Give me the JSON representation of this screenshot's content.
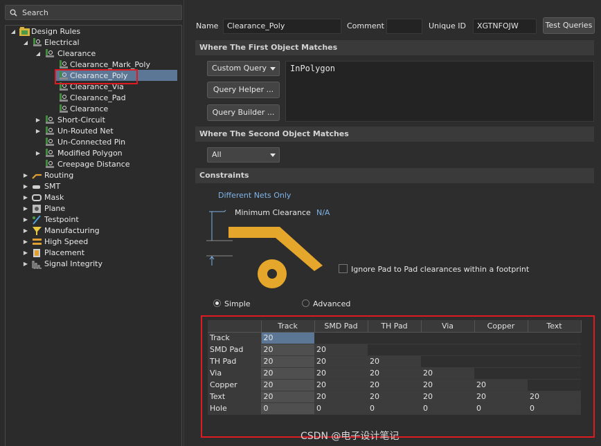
{
  "search": {
    "placeholder": "Search",
    "icon": "search-icon"
  },
  "tree": {
    "root": "Design Rules",
    "electrical": "Electrical",
    "clearance": "Clearance",
    "clearance_children": [
      "Clearance_Mark_Poly",
      "Clearance_Poly",
      "Clearance_Via",
      "Clearance_Pad",
      "Clearance"
    ],
    "electrical_children": [
      "Short-Circuit",
      "Un-Routed Net",
      "Un-Connected Pin",
      "Modified Polygon",
      "Creepage Distance"
    ],
    "categories": [
      "Routing",
      "SMT",
      "Mask",
      "Plane",
      "Testpoint",
      "Manufacturing",
      "High Speed",
      "Placement",
      "Signal Integrity"
    ]
  },
  "rule": {
    "name_label": "Name",
    "name_value": "Clearance_Poly",
    "comment_label": "Comment",
    "comment_value": "",
    "uid_label": "Unique ID",
    "uid_value": "XGTNFOJW",
    "test_button": "Test Queries"
  },
  "first_object": {
    "header": "Where The First Object Matches",
    "combo": "Custom Query",
    "query_helper": "Query Helper ...",
    "query_builder": "Query Builder ...",
    "query_text": "InPolygon"
  },
  "second_object": {
    "header": "Where The Second Object Matches",
    "combo": "All"
  },
  "constraints": {
    "header": "Constraints",
    "net_scope": "Different Nets Only",
    "min_clearance_label": "Minimum Clearance",
    "min_clearance_value": "N/A",
    "ignore_pad_label": "Ignore Pad to Pad clearances within a footprint",
    "mode_simple": "Simple",
    "mode_advanced": "Advanced",
    "selected_mode": "Simple"
  },
  "grid": {
    "columns": [
      "Track",
      "SMD Pad",
      "TH Pad",
      "Via",
      "Copper",
      "Text"
    ],
    "rows": [
      {
        "name": "Track",
        "values": [
          "20"
        ]
      },
      {
        "name": "SMD Pad",
        "values": [
          "20",
          "20"
        ]
      },
      {
        "name": "TH Pad",
        "values": [
          "20",
          "20",
          "20"
        ]
      },
      {
        "name": "Via",
        "values": [
          "20",
          "20",
          "20",
          "20"
        ]
      },
      {
        "name": "Copper",
        "values": [
          "20",
          "20",
          "20",
          "20",
          "20"
        ]
      },
      {
        "name": "Text",
        "values": [
          "20",
          "20",
          "20",
          "20",
          "20",
          "20"
        ]
      },
      {
        "name": "Hole",
        "values": [
          "0",
          "0",
          "0",
          "0",
          "0",
          "0"
        ]
      }
    ]
  },
  "watermark": "CSDN @电子设计笔记",
  "colors": {
    "accent": "#e01a22",
    "selection": "#5b7795",
    "diagram": "#e4a72c",
    "link": "#7fb4e8"
  }
}
